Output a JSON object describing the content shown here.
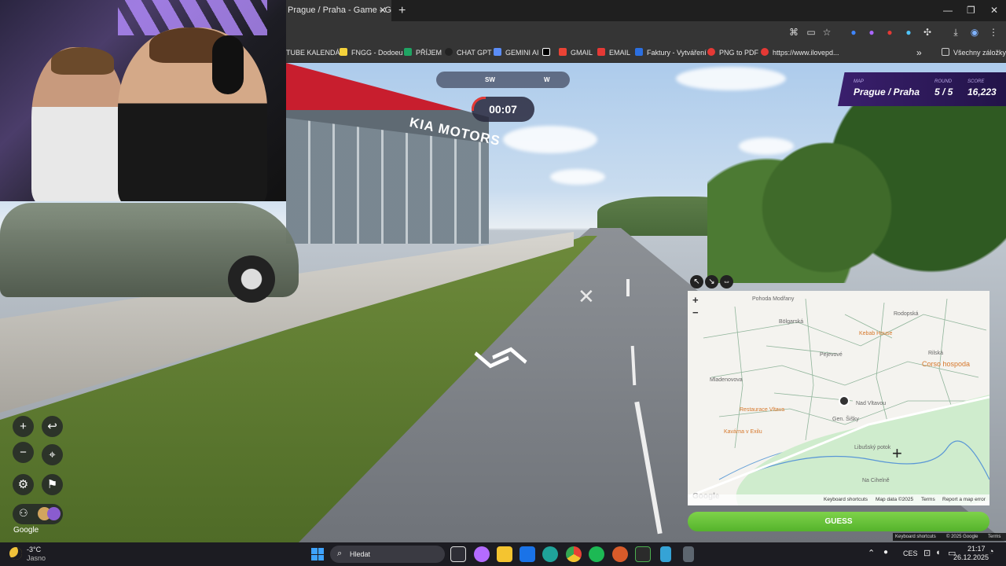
{
  "browser": {
    "tab_title": "Prague / Praha - Game - GeoG",
    "close_glyph": "✕",
    "new_tab_glyph": "+",
    "window_controls": [
      "—",
      "❐",
      "✕"
    ]
  },
  "bookmarks": [
    {
      "label": "TUBE KALENDÁŘ",
      "color": "#353535"
    },
    {
      "label": "FNGG - Dodoeu",
      "color": "#f3d13b"
    },
    {
      "label": "PŘÍJEM",
      "color": "#1fa463"
    },
    {
      "label": "CHAT GPT",
      "color": "#222222"
    },
    {
      "label": "GEMINI AI",
      "color": "#5b8df7"
    },
    {
      "label": "",
      "color": "#000000"
    },
    {
      "label": "GMAIL",
      "color": "#ea4335"
    },
    {
      "label": "EMAIL",
      "color": "#e53935"
    },
    {
      "label": "Faktury - Vytváření",
      "color": "#2b6fe0"
    },
    {
      "label": "PNG to PDF",
      "color": "#e53935"
    },
    {
      "label": "https://www.ilovepd...",
      "color": "#e53935"
    }
  ],
  "bookmarks_more": "»",
  "bookmarks_folder": "Všechny záložky",
  "compass": {
    "left": "SW",
    "right": "W"
  },
  "timer": "00:07",
  "status": {
    "map_label": "MAP",
    "map_value": "Prague / Praha",
    "round_label": "ROUND",
    "round_value": "5 / 5",
    "score_label": "SCORE",
    "score_value": "16,223"
  },
  "scene": {
    "sign_text": "KIA MOTORS",
    "road_marking": "✕",
    "nav_arrow": "︿"
  },
  "controls": {
    "zoom_in": "+",
    "zoom_out": "−",
    "undo": "↩",
    "checkpoint": "⌖",
    "settings": "⚙",
    "flag": "⚑",
    "people": "⚇",
    "google": "Google"
  },
  "map": {
    "zoom_in": "+",
    "zoom_out": "−",
    "tools": [
      "↖",
      "↘",
      "⇔"
    ],
    "labels": [
      {
        "text": "Pohoda Modřany",
        "orange": false
      },
      {
        "text": "Kebab House",
        "orange": true
      },
      {
        "text": "Corso hospoda",
        "orange": true
      },
      {
        "text": "Restaurace Vltava",
        "orange": true
      },
      {
        "text": "Kavárna v Exilu",
        "orange": true
      },
      {
        "text": "Rodopská",
        "orange": false
      },
      {
        "text": "Pejevové",
        "orange": false
      },
      {
        "text": "Gen. Šišky",
        "orange": false
      },
      {
        "text": "Libušský potok",
        "orange": false
      },
      {
        "text": "Na Cihelně",
        "orange": false
      },
      {
        "text": "Rilská",
        "orange": false
      },
      {
        "text": "Nad Vltavou",
        "orange": false
      },
      {
        "text": "Bölgarská",
        "orange": false
      },
      {
        "text": "Mladenovova",
        "orange": false
      }
    ],
    "google": "Google",
    "footer": [
      "Keyboard shortcuts",
      "Map data ©2025",
      "Terms",
      "Report a map error"
    ],
    "crosshair": "+"
  },
  "guess_label": "GUESS",
  "sv_footer": [
    "Keyboard shortcuts",
    "© 2025 Google",
    "Terms"
  ],
  "taskbar": {
    "temp": "-3°C",
    "weather": "Jasno",
    "search_placeholder": "Hledat",
    "lang": "CES",
    "time": "21:17",
    "date": "26.12.2025",
    "apps": [
      {
        "name": "task-view",
        "color": "#2e2e36"
      },
      {
        "name": "copilot",
        "color": "#b46bff"
      },
      {
        "name": "file-explorer",
        "color": "#f4c430"
      },
      {
        "name": "outlook",
        "color": "#1a73e8"
      },
      {
        "name": "edge",
        "color": "#1fa39a"
      },
      {
        "name": "chrome",
        "color": "#e84235"
      },
      {
        "name": "spotify",
        "color": "#1db954"
      },
      {
        "name": "obs",
        "color": "#d85b2a"
      },
      {
        "name": "terminal",
        "color": "#2b2b2b"
      },
      {
        "name": "notepad",
        "color": "#35a3d6"
      },
      {
        "name": "calculator",
        "color": "#5d6670"
      }
    ],
    "tray": [
      "⌃",
      "🎙",
      "⊡",
      "🔊",
      "🔋"
    ]
  }
}
